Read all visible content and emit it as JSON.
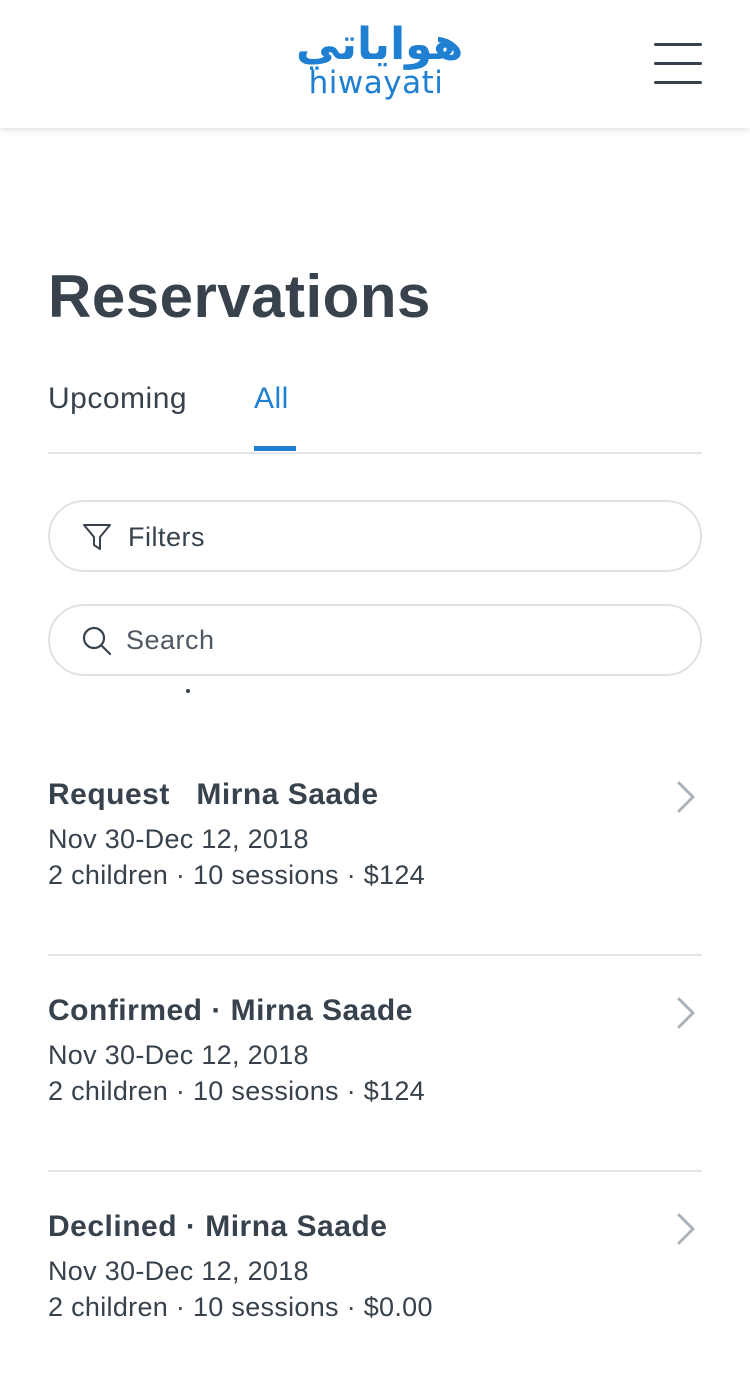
{
  "header": {
    "logo_ar": "هواياتي",
    "logo_en": "hiwayati",
    "menu_icon": "hamburger-menu-icon"
  },
  "page": {
    "title": "Reservations"
  },
  "tabs": [
    {
      "label": "Upcoming",
      "active": false
    },
    {
      "label": "All",
      "active": true
    }
  ],
  "filters": {
    "label": "Filters",
    "icon": "filter-funnel-icon"
  },
  "search": {
    "placeholder": "Search",
    "value": "",
    "icon": "search-icon"
  },
  "colors": {
    "accent": "#1f7fd0",
    "text": "#37424d",
    "divider": "#e3e6e9"
  },
  "reservations": [
    {
      "title": "Request   Mirna Saade",
      "dates": "Nov 30-Dec 12, 2018",
      "meta": "2 children · 10 sessions · $124"
    },
    {
      "title": "Confirmed · Mirna Saade",
      "dates": "Nov 30-Dec 12, 2018",
      "meta": "2 children · 10 sessions · $124"
    },
    {
      "title": "Declined · Mirna Saade",
      "dates": "Nov 30-Dec 12, 2018",
      "meta": "2 children · 10 sessions · $0.00"
    }
  ]
}
